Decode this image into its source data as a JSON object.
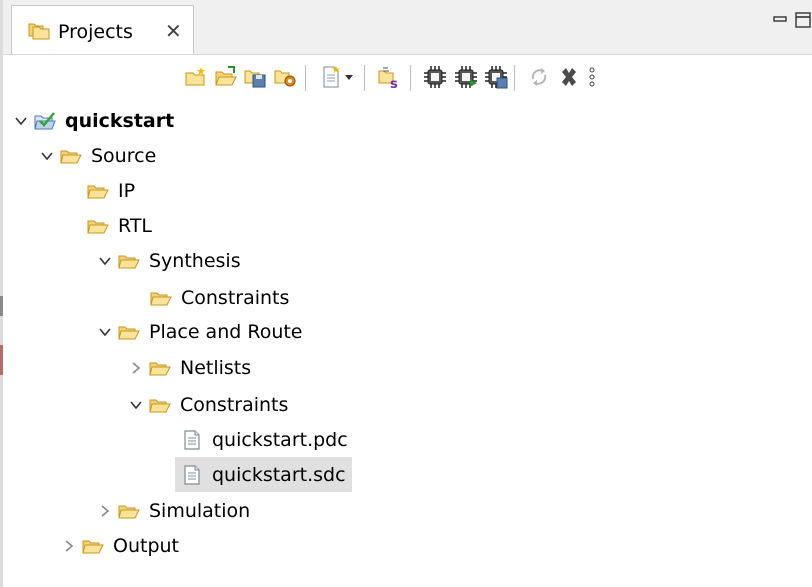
{
  "panel": {
    "tab_label": "Projects",
    "tab_close_glyph": "✕",
    "tab_icon": "projects-folder-icon",
    "controls": [
      "minimize-icon",
      "maximize-icon"
    ]
  },
  "toolbar": {
    "buttons": [
      "new-project-icon",
      "open-project-icon",
      "save-project-icon",
      "project-settings-icon",
      "new-file-icon",
      "dropdown-arrow-icon",
      "script-icon",
      "chip-icon",
      "chip-run-icon",
      "chip-save-icon",
      "refresh-icon",
      "close-icon",
      "more-icon"
    ]
  },
  "tree": {
    "root": {
      "label": "quickstart",
      "expanded": true
    },
    "items": [
      {
        "label": "Source",
        "expanded": true
      },
      {
        "label": "IP"
      },
      {
        "label": "RTL"
      },
      {
        "label": "Synthesis",
        "expanded": true
      },
      {
        "label": "Constraints"
      },
      {
        "label": "Place and Route",
        "expanded": true
      },
      {
        "label": "Netlists",
        "expanded": false
      },
      {
        "label": "Constraints",
        "expanded": true
      },
      {
        "label": "quickstart.pdc"
      },
      {
        "label": "quickstart.sdc",
        "selected": true
      },
      {
        "label": "Simulation",
        "expanded": false
      },
      {
        "label": "Output",
        "expanded": false
      }
    ]
  },
  "colors": {
    "folder_fill": "#fbe49a",
    "folder_stroke": "#c8961e",
    "selection": "#e0e0e0",
    "project_check": "#3aa13a"
  }
}
